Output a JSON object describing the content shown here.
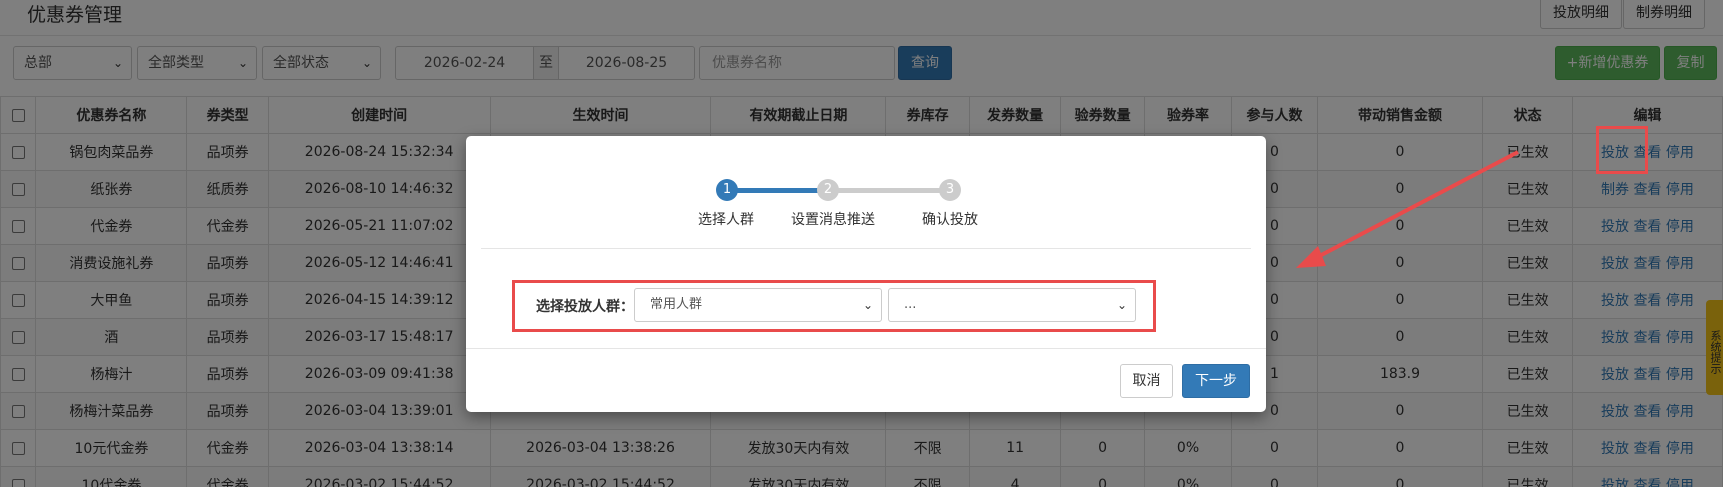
{
  "header": {
    "title": "优惠券管理",
    "btn_issue_detail": "投放明细",
    "btn_make_detail": "制券明细"
  },
  "filters": {
    "dept": "总部",
    "type": "全部类型",
    "status": "全部状态",
    "date_from": "2026-02-24",
    "date_to_label": "至",
    "date_to": "2026-08-25",
    "name_placeholder": "优惠券名称",
    "query": "查询",
    "add": "+新增优惠券",
    "copy": "复制"
  },
  "table": {
    "headers": [
      "优惠券名称",
      "券类型",
      "创建时间",
      "生效时间",
      "有效期截止日期",
      "券库存",
      "发券数量",
      "验券数量",
      "验券率",
      "参与人数",
      "带动销售金额",
      "状态",
      "编辑"
    ],
    "rows": [
      {
        "name": "锅包肉菜品券",
        "type": "品项券",
        "created": "2026-08-24 15:32:34",
        "effective": "",
        "expiry": "",
        "stock": "",
        "issued": "",
        "verified": "",
        "rate": "",
        "people": "0",
        "sales": "0",
        "status": "已生效",
        "a1": "投放",
        "a2": "查看",
        "a3": "停用"
      },
      {
        "name": "纸张券",
        "type": "纸质券",
        "created": "2026-08-10 14:46:32",
        "effective": "",
        "expiry": "",
        "stock": "",
        "issued": "",
        "verified": "",
        "rate": "",
        "people": "0",
        "sales": "0",
        "status": "已生效",
        "a1": "制券",
        "a2": "查看",
        "a3": "停用"
      },
      {
        "name": "代金券",
        "type": "代金券",
        "created": "2026-05-21 11:07:02",
        "effective": "",
        "expiry": "",
        "stock": "",
        "issued": "",
        "verified": "",
        "rate": "",
        "people": "0",
        "sales": "0",
        "status": "已生效",
        "a1": "投放",
        "a2": "查看",
        "a3": "停用"
      },
      {
        "name": "消费设施礼券",
        "type": "品项券",
        "created": "2026-05-12 14:46:41",
        "effective": "",
        "expiry": "",
        "stock": "",
        "issued": "",
        "verified": "",
        "rate": "",
        "people": "0",
        "sales": "0",
        "status": "已生效",
        "a1": "投放",
        "a2": "查看",
        "a3": "停用"
      },
      {
        "name": "大甲鱼",
        "type": "品项券",
        "created": "2026-04-15 14:39:12",
        "effective": "",
        "expiry": "",
        "stock": "",
        "issued": "",
        "verified": "",
        "rate": "",
        "people": "0",
        "sales": "0",
        "status": "已生效",
        "a1": "投放",
        "a2": "查看",
        "a3": "停用"
      },
      {
        "name": "酒",
        "type": "品项券",
        "created": "2026-03-17 15:48:17",
        "effective": "",
        "expiry": "",
        "stock": "",
        "issued": "",
        "verified": "",
        "rate": "",
        "people": "0",
        "sales": "0",
        "status": "已生效",
        "a1": "投放",
        "a2": "查看",
        "a3": "停用"
      },
      {
        "name": "杨梅汁",
        "type": "品项券",
        "created": "2026-03-09 09:41:38",
        "effective": "",
        "expiry": "",
        "stock": "",
        "issued": "",
        "verified": "",
        "rate": "",
        "people": "1",
        "sales": "183.9",
        "status": "已生效",
        "a1": "投放",
        "a2": "查看",
        "a3": "停用"
      },
      {
        "name": "杨梅汁菜品券",
        "type": "品项券",
        "created": "2026-03-04 13:39:01",
        "effective": "",
        "expiry": "",
        "stock": "",
        "issued": "",
        "verified": "",
        "rate": "",
        "people": "0",
        "sales": "0",
        "status": "已生效",
        "a1": "投放",
        "a2": "查看",
        "a3": "停用"
      },
      {
        "name": "10元代金券",
        "type": "代金券",
        "created": "2026-03-04 13:38:14",
        "effective": "2026-03-04 13:38:26",
        "expiry": "发放30天内有效",
        "stock": "不限",
        "issued": "11",
        "verified": "0",
        "rate": "0%",
        "people": "0",
        "sales": "0",
        "status": "已生效",
        "a1": "投放",
        "a2": "查看",
        "a3": "停用"
      },
      {
        "name": "10代金券",
        "type": "代金券",
        "created": "2026-03-02 15:44:52",
        "effective": "2026-03-02 15:44:52",
        "expiry": "发放30天内有效",
        "stock": "不限",
        "issued": "4",
        "verified": "0",
        "rate": "0%",
        "people": "0",
        "sales": "0",
        "status": "已生效",
        "a1": "投放",
        "a2": "查看",
        "a3": "停用"
      }
    ]
  },
  "side_tab": "系统提示",
  "modal": {
    "steps": [
      {
        "num": "1",
        "label": "选择人群"
      },
      {
        "num": "2",
        "label": "设置消息推送"
      },
      {
        "num": "3",
        "label": "确认投放"
      }
    ],
    "field_label": "选择投放人群：",
    "crowd_select": "常用人群",
    "crowd_sub_select": "...",
    "cancel": "取消",
    "next": "下一步"
  },
  "colors": {
    "accent": "#337ab7",
    "success": "#5cb85c",
    "highlight": "#e94b4b",
    "inactive_step": "#cccccc"
  }
}
